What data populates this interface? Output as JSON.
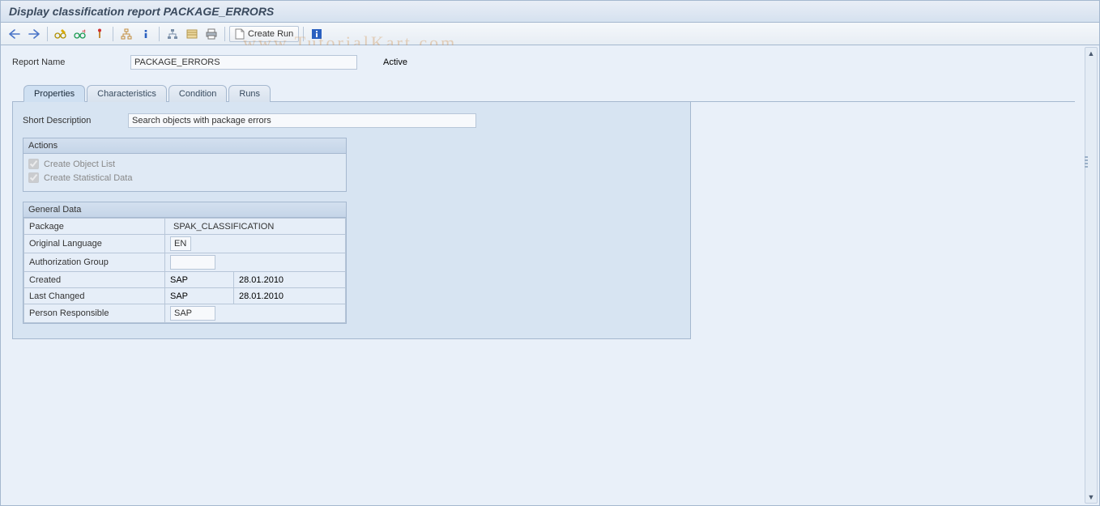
{
  "title": "Display classification report PACKAGE_ERRORS",
  "toolbar": {
    "create_run": "Create Run"
  },
  "header": {
    "report_name_label": "Report Name",
    "report_name_value": "PACKAGE_ERRORS",
    "status_label": "Active"
  },
  "tabs": {
    "properties": "Properties",
    "characteristics": "Characteristics",
    "condition": "Condition",
    "runs": "Runs",
    "active": "properties"
  },
  "properties": {
    "short_desc_label": "Short Description",
    "short_desc_value": "Search objects with package errors",
    "actions_title": "Actions",
    "create_object_list": "Create Object List",
    "create_statistical_data": "Create Statistical Data",
    "general_data_title": "General Data",
    "rows": {
      "package": {
        "label": "Package",
        "v": "SPAK_CLASSIFICATION"
      },
      "orig_lang": {
        "label": "Original Language",
        "v": "EN"
      },
      "auth_group": {
        "label": "Authorization Group",
        "v": ""
      },
      "created": {
        "label": "Created",
        "v1": "SAP",
        "v2": "28.01.2010"
      },
      "last_changed": {
        "label": "Last Changed",
        "v1": "SAP",
        "v2": "28.01.2010"
      },
      "responsible": {
        "label": "Person Responsible",
        "v": "SAP"
      }
    }
  },
  "watermark": "www.TutorialKart.com"
}
